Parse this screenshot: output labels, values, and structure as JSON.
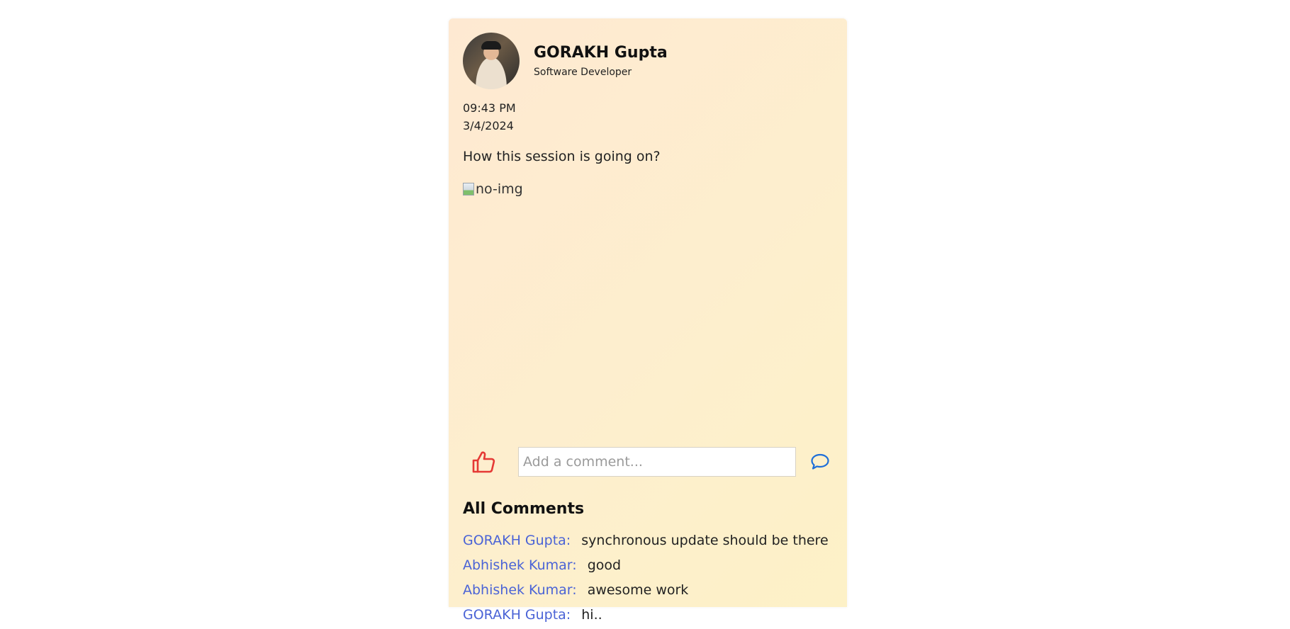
{
  "post": {
    "author": {
      "name": "GORAKH Gupta",
      "role": "Software Developer",
      "avatar_icon": "user-photo"
    },
    "time": "09:43 PM",
    "date": "3/4/2024",
    "text": "How this session is going on?",
    "image_alt": "no-img"
  },
  "actions": {
    "like_icon": "thumbs-up-icon",
    "like_color": "#e53935",
    "comment_placeholder": "Add a comment...",
    "send_icon": "speech-bubble-icon",
    "send_color": "#1e6fd9"
  },
  "comments": {
    "title": "All Comments",
    "items": [
      {
        "author": "GORAKH Gupta:",
        "text": "synchronous update should be there"
      },
      {
        "author": "Abhishek Kumar:",
        "text": "good"
      },
      {
        "author": "Abhishek Kumar:",
        "text": "awesome work"
      },
      {
        "author": "GORAKH Gupta:",
        "text": "hi.."
      }
    ]
  },
  "colors": {
    "card_gradient_start": "#fee9d2",
    "card_gradient_end": "#fdf1c7",
    "comment_author": "#4a63d6"
  }
}
